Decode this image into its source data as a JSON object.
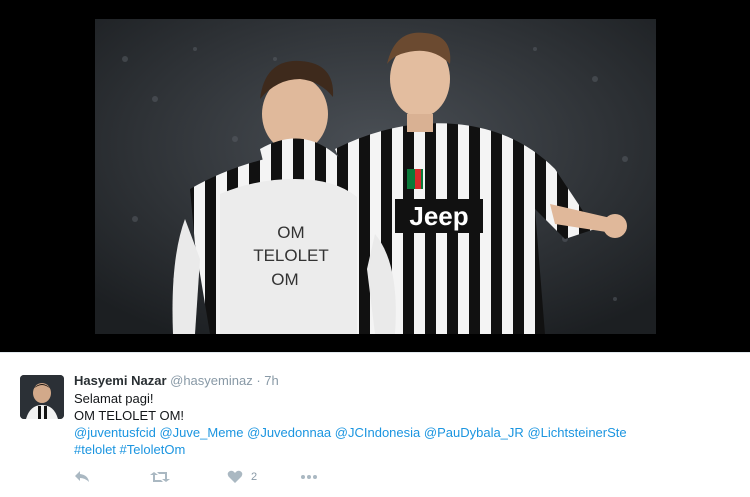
{
  "media": {
    "shirt_text": [
      "OM",
      "TELOLET",
      "OM"
    ],
    "sponsor_text": "Jeep"
  },
  "tweet": {
    "author_name": "Hasyemi Nazar",
    "author_handle": "@hasyeminaz",
    "separator": "·",
    "time": "7h",
    "line1": "Selamat pagi!",
    "line2": "OM TELOLET OM!",
    "mentions": [
      "@juventusfcid",
      "@Juve_Meme",
      "@Juvedonnaa",
      "@JCIndonesia",
      "@PauDybala_JR",
      "@LichtsteinerSte"
    ],
    "hashtags": [
      "#telolet",
      "#TeloletOm"
    ]
  },
  "actions": {
    "reply_icon": "reply-icon",
    "retweet_icon": "retweet-icon",
    "like_icon": "heart-icon",
    "like_count": "2",
    "more_icon": "more-icon"
  },
  "colors": {
    "link": "#1b95e0",
    "action_icon": "#aab8c2",
    "name": "#292f33",
    "muted": "#8899a6"
  }
}
